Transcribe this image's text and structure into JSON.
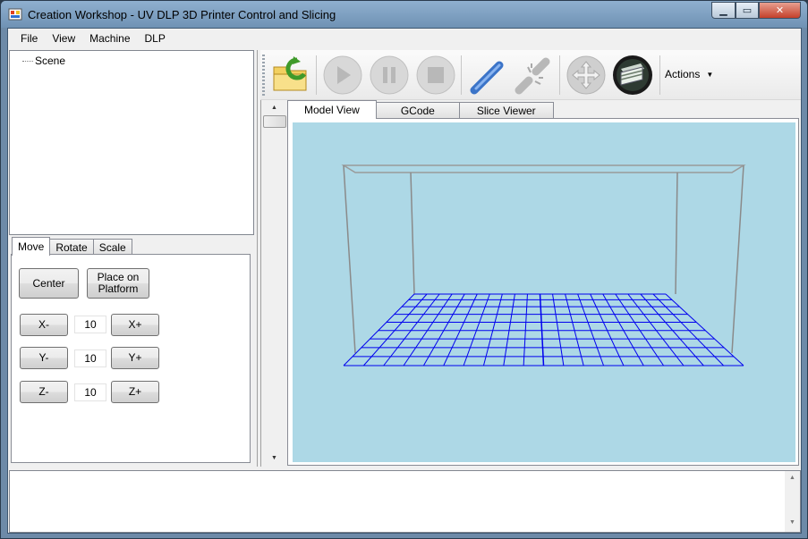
{
  "window": {
    "title": "Creation Workshop - UV DLP 3D Printer Control and Slicing",
    "controls": {
      "minimize": "▁",
      "maximize": "▭",
      "close": "✕"
    }
  },
  "menu": [
    "File",
    "View",
    "Machine",
    "DLP"
  ],
  "tree": {
    "root": "Scene"
  },
  "transform_tabs": [
    "Move",
    "Rotate",
    "Scale"
  ],
  "move_panel": {
    "center": "Center",
    "place_on_platform": "Place on Platform",
    "x_minus": "X-",
    "x_plus": "X+",
    "x_value": "10",
    "y_minus": "Y-",
    "y_plus": "Y+",
    "y_value": "10",
    "z_minus": "Z-",
    "z_plus": "Z+",
    "z_value": "10"
  },
  "toolbar": {
    "icons": [
      "open-file-icon",
      "play-icon",
      "pause-icon",
      "stop-icon",
      "connect-icon",
      "disconnect-icon",
      "move-icon",
      "slice-icon"
    ],
    "actions_label": "Actions",
    "colors": {
      "disabled": "#b8b8b8",
      "connect": "#3b74c8"
    }
  },
  "view_tabs": [
    "Model View",
    "GCode",
    "Slice Viewer"
  ],
  "viewport": {
    "background": "#add8e6",
    "grid_color": "#0000ee",
    "box_color": "#8a8a8a"
  }
}
